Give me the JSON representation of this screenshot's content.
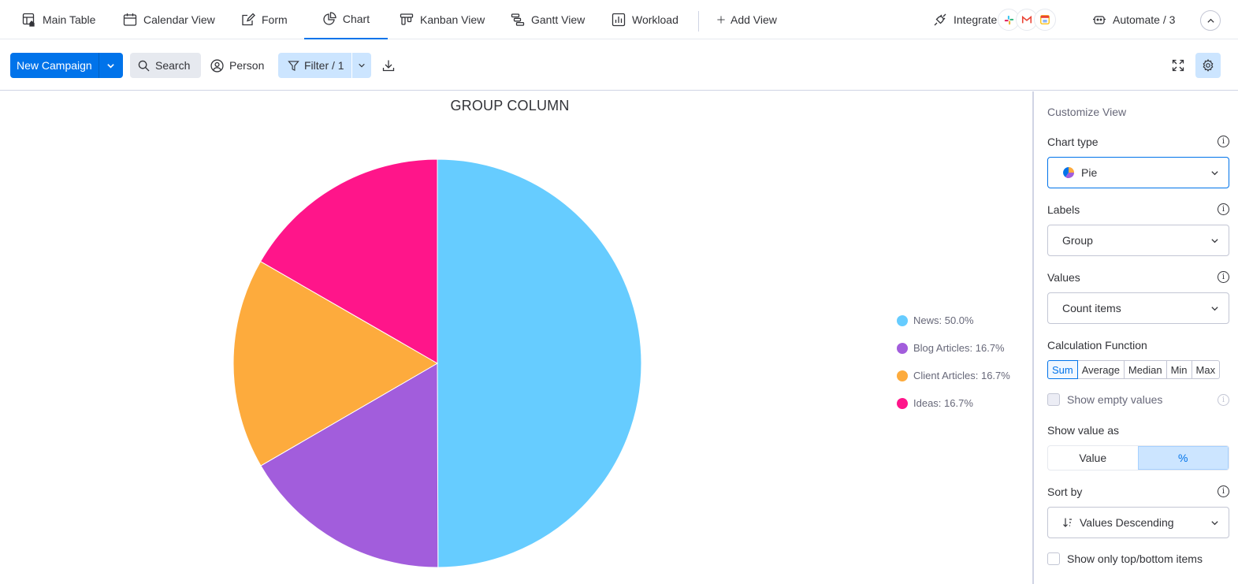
{
  "tabs": [
    {
      "label": "Main Table",
      "icon": "table-icon"
    },
    {
      "label": "Calendar View",
      "icon": "calendar-icon"
    },
    {
      "label": "Form",
      "icon": "form-icon"
    },
    {
      "label": "Chart",
      "icon": "pie-chart-icon",
      "active": true
    },
    {
      "label": "Kanban View",
      "icon": "kanban-icon"
    },
    {
      "label": "Gantt View",
      "icon": "gantt-icon"
    },
    {
      "label": "Workload",
      "icon": "workload-icon"
    },
    {
      "label": "Add View",
      "icon": "plus-icon"
    }
  ],
  "header_right": {
    "integrate_label": "Integrate",
    "automate_label": "Automate / 3"
  },
  "toolbar": {
    "new_label": "New Campaign",
    "search_label": "Search",
    "person_label": "Person",
    "filter_label": "Filter / 1"
  },
  "chart_data": {
    "type": "pie",
    "title": "GROUP COLUMN",
    "categories": [
      "News",
      "Blog Articles",
      "Client Articles",
      "Ideas"
    ],
    "values": [
      50.0,
      16.7,
      16.7,
      16.7
    ],
    "legend_labels": [
      "News: 50.0%",
      "Blog Articles: 16.7%",
      "Client Articles: 16.7%",
      "Ideas: 16.7%"
    ],
    "colors": [
      "#66ccff",
      "#a25ddc",
      "#fdab3d",
      "#ff158a"
    ],
    "legend_position": "right"
  },
  "panel": {
    "title": "Customize View",
    "chart_type_label": "Chart type",
    "chart_type_value": "Pie",
    "labels_label": "Labels",
    "labels_value": "Group",
    "values_label": "Values",
    "values_value": "Count items",
    "calc_label": "Calculation Function",
    "calc_options": [
      "Sum",
      "Average",
      "Median",
      "Min",
      "Max"
    ],
    "calc_selected": "Sum",
    "show_empty_label": "Show empty values",
    "show_value_as_label": "Show value as",
    "value_option": "Value",
    "percent_option": "%",
    "sort_label": "Sort by",
    "sort_value": "Values Descending",
    "top_bottom_label": "Show only top/bottom items",
    "info_glyph": "i"
  },
  "accent_color": "#0073ea"
}
